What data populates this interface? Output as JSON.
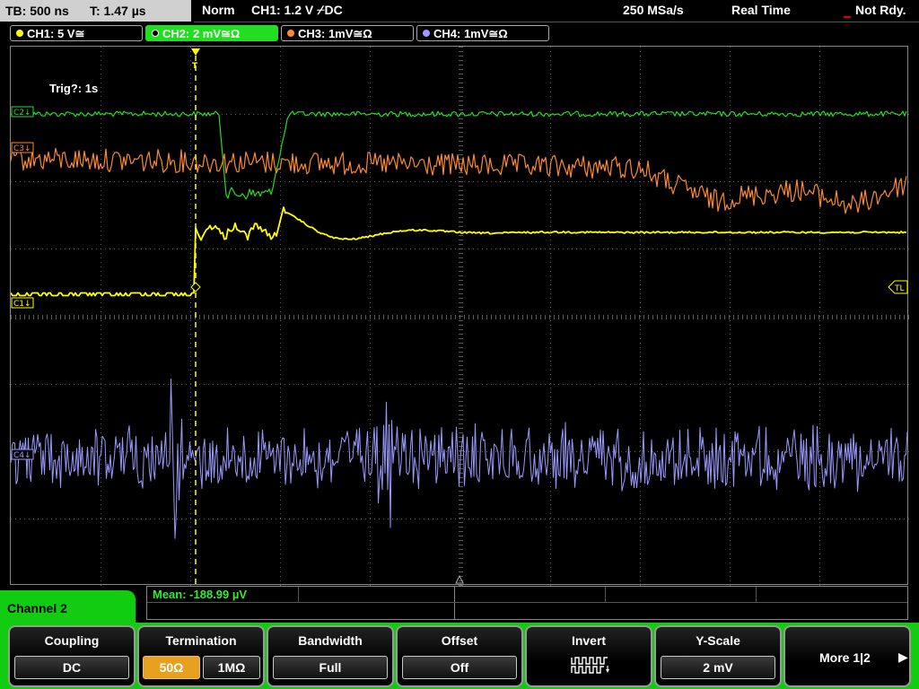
{
  "status_bar": {
    "timebase": "TB: 500 ns",
    "time_offset": "T: 1.47 µs",
    "trigger_mode": "Norm",
    "trigger_info": "CH1: 1.2 V ⌿DC",
    "sample_rate": "250 MSa/s",
    "acq_mode": "Real Time",
    "status": "Not Rdy."
  },
  "channel_tabs": [
    {
      "label": "CH1: 5 V≅",
      "color": "#ffff00",
      "active": false
    },
    {
      "label": "CH2: 2 mV≅Ω",
      "color": "#22dd22",
      "active": true
    },
    {
      "label": "CH3: 1mV≅Ω",
      "color": "#ff8a2a",
      "active": false
    },
    {
      "label": "CH4: 1mV≅Ω",
      "color": "#9a9aff",
      "active": false
    }
  ],
  "plot": {
    "trigger_text": "Trig?: 1s",
    "markers": {
      "ch2": "C2↓",
      "ch3": "C3↓",
      "ch1": "C1↓",
      "ch4": "C4↓",
      "trigger_level": "TL",
      "trigger_pos": "T"
    },
    "colors": {
      "ch1": "#ffff00",
      "ch2": "#22dd22",
      "ch3": "#ff8a2a",
      "ch4": "#9a9aff",
      "grid": "#5a5a5a"
    }
  },
  "measurement": {
    "mean": "Mean: -188.99 µV"
  },
  "softkeys": {
    "panel_title": "Channel 2",
    "coupling": {
      "label": "Coupling",
      "value": "DC"
    },
    "termination": {
      "label": "Termination",
      "opt1": "50Ω",
      "opt2": "1MΩ",
      "selected": "50Ω"
    },
    "bandwidth": {
      "label": "Bandwidth",
      "value": "Full"
    },
    "offset": {
      "label": "Offset",
      "value": "Off"
    },
    "invert": {
      "label": "Invert",
      "icon": "invert-waveform-icon"
    },
    "yscale": {
      "label": "Y-Scale",
      "value": "2 mV"
    },
    "more": {
      "label": "More 1|2",
      "icon": "arrow-right-icon"
    }
  }
}
